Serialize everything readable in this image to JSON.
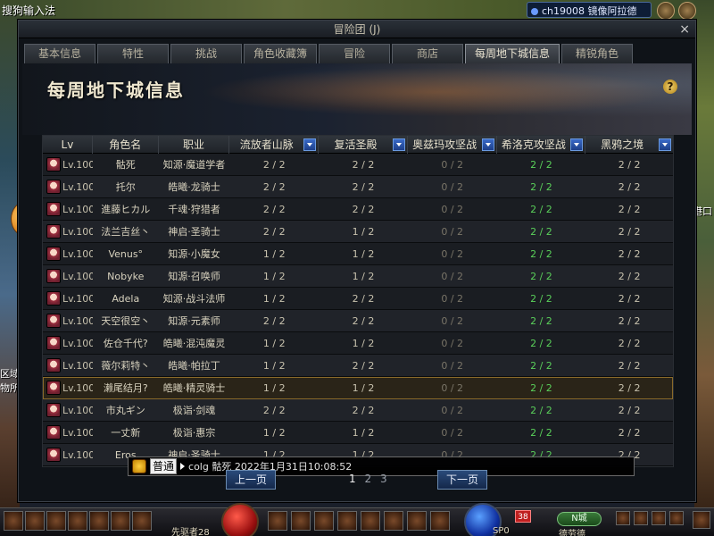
{
  "ime_label": "搜狗输入法",
  "server": {
    "name": "ch19008 镜像阿拉德"
  },
  "window": {
    "title": "冒险团 (J)",
    "close_glyph": "×",
    "tabs": [
      "基本信息",
      "特性",
      "挑战",
      "角色收藏簿",
      "冒险",
      "商店",
      "每周地下城信息",
      "精锐角色"
    ],
    "active_tab_index": 6,
    "banner_title": "每周地下城信息",
    "help_glyph": "?"
  },
  "table": {
    "columns": [
      "Lv",
      "角色名",
      "职业",
      "流放者山脉",
      "复活圣殿",
      "奥兹玛攻坚战",
      "希洛克攻坚战",
      "黑鸦之境"
    ],
    "rows": [
      {
        "lv": "Lv.100",
        "name": "骷死",
        "job": "知源·魔道学者",
        "d1": "2 / 2",
        "d2": "2 / 2",
        "d3": "0 / 2",
        "d4": "2 / 2",
        "d5": "2 / 2"
      },
      {
        "lv": "Lv.100",
        "name": "托尔",
        "job": "皓曦·龙骑士",
        "d1": "2 / 2",
        "d2": "2 / 2",
        "d3": "0 / 2",
        "d4": "2 / 2",
        "d5": "2 / 2"
      },
      {
        "lv": "Lv.100",
        "name": "進藤ヒカル",
        "job": "千魂·狩猎者",
        "d1": "2 / 2",
        "d2": "2 / 2",
        "d3": "0 / 2",
        "d4": "2 / 2",
        "d5": "2 / 2"
      },
      {
        "lv": "Lv.100",
        "name": "法兰吉丝丶",
        "job": "神启·圣骑士",
        "d1": "2 / 2",
        "d2": "1 / 2",
        "d3": "0 / 2",
        "d4": "2 / 2",
        "d5": "2 / 2"
      },
      {
        "lv": "Lv.100",
        "name": "Venus°",
        "job": "知源·小魔女",
        "d1": "1 / 2",
        "d2": "1 / 2",
        "d3": "0 / 2",
        "d4": "2 / 2",
        "d5": "2 / 2"
      },
      {
        "lv": "Lv.100",
        "name": "Nobyke",
        "job": "知源·召唤师",
        "d1": "1 / 2",
        "d2": "1 / 2",
        "d3": "0 / 2",
        "d4": "2 / 2",
        "d5": "2 / 2"
      },
      {
        "lv": "Lv.100",
        "name": "Adela",
        "job": "知源·战斗法师",
        "d1": "1 / 2",
        "d2": "2 / 2",
        "d3": "0 / 2",
        "d4": "2 / 2",
        "d5": "2 / 2"
      },
      {
        "lv": "Lv.100",
        "name": "天空很空丶",
        "job": "知源·元素师",
        "d1": "2 / 2",
        "d2": "2 / 2",
        "d3": "0 / 2",
        "d4": "2 / 2",
        "d5": "2 / 2"
      },
      {
        "lv": "Lv.100",
        "name": "佐仓千代?",
        "job": "皓曦·混沌魔灵",
        "d1": "1 / 2",
        "d2": "1 / 2",
        "d3": "0 / 2",
        "d4": "2 / 2",
        "d5": "2 / 2"
      },
      {
        "lv": "Lv.100",
        "name": "薇尔莉特丶",
        "job": "皓曦·帕拉丁",
        "d1": "1 / 2",
        "d2": "2 / 2",
        "d3": "0 / 2",
        "d4": "2 / 2",
        "d5": "2 / 2"
      },
      {
        "lv": "Lv.100",
        "name": "濑尾结月?",
        "job": "皓曦·精灵骑士",
        "d1": "1 / 2",
        "d2": "1 / 2",
        "d3": "0 / 2",
        "d4": "2 / 2",
        "d5": "2 / 2"
      },
      {
        "lv": "Lv.100",
        "name": "市丸ギン",
        "job": "极诣·剑魂",
        "d1": "2 / 2",
        "d2": "2 / 2",
        "d3": "0 / 2",
        "d4": "2 / 2",
        "d5": "2 / 2"
      },
      {
        "lv": "Lv.100",
        "name": "一丈新",
        "job": "极诣·惠宗",
        "d1": "1 / 2",
        "d2": "1 / 2",
        "d3": "0 / 2",
        "d4": "2 / 2",
        "d5": "2 / 2"
      },
      {
        "lv": "Lv.100",
        "name": "Eros",
        "job": "神启·圣骑士",
        "d1": "1 / 2",
        "d2": "1 / 2",
        "d3": "0 / 2",
        "d4": "2 / 2",
        "d5": "2 / 2"
      }
    ],
    "highlighted_row_index": 10
  },
  "tooltip": {
    "tag": "普通",
    "text": "colg 骷死  2022年1月31日10:08:52"
  },
  "pager": {
    "prev_label": "上一页",
    "next_label": "下一页",
    "pages": [
      "1",
      "2",
      "3"
    ],
    "current_page": "1"
  },
  "hud": {
    "name_text": "先驱者28",
    "sp_text": "SP0",
    "badge_text": "38",
    "town_label": "N城",
    "right_text": "德劳德"
  },
  "side_labels": {
    "right": "港口",
    "left_1": "区域",
    "left_2": "物所"
  },
  "colors": {
    "green_value": "#5ad05a",
    "dim_value": "#7a7568",
    "highlight_outline": "#8a6a2a"
  }
}
